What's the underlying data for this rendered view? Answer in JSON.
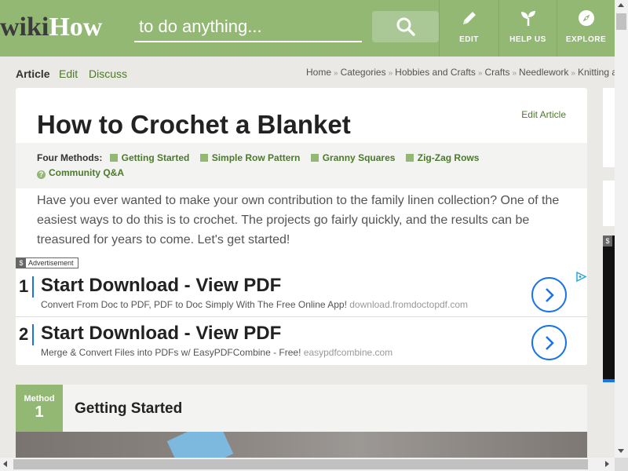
{
  "header": {
    "logo_wiki": "wiki",
    "logo_how": "How",
    "search_placeholder": "to do anything...",
    "search_icon": "search-icon",
    "buttons": [
      {
        "label": "EDIT",
        "icon": "pencil-icon"
      },
      {
        "label": "HELP US",
        "icon": "sprout-icon"
      },
      {
        "label": "EXPLORE",
        "icon": "compass-icon"
      }
    ]
  },
  "tabs": {
    "article": "Article",
    "edit": "Edit",
    "discuss": "Discuss"
  },
  "breadcrumb": [
    "Home",
    "Categories",
    "Hobbies and Crafts",
    "Crafts",
    "Needlework",
    "Knitting a"
  ],
  "breadcrumb_sep": "»",
  "article": {
    "title": "How to Crochet a Blanket",
    "edit_link": "Edit Article",
    "methods_label": "Four Methods:",
    "methods": [
      "Getting Started",
      "Simple Row Pattern",
      "Granny Squares",
      "Zig-Zag Rows"
    ],
    "qa_link": "Community Q&A",
    "intro": "Have you ever wanted to make your own contribution to the family linen collection? One of the easiest ways to do this is to crochet. The projects go fairly quickly, and the results can be treasured for years to come. Let's get started!"
  },
  "ad": {
    "label_icon": "$",
    "label": "Advertisement",
    "items": [
      {
        "num": "1",
        "title": "Start Download - View PDF",
        "desc": "Convert From Doc to PDF, PDF to Doc Simply With The Free Online App!",
        "domain": "download.fromdoctopdf.com"
      },
      {
        "num": "2",
        "title": "Start Download - View PDF",
        "desc": "Merge & Convert Files into PDFs w/ EasyPDFCombine - Free!",
        "domain": "easypdfcombine.com"
      }
    ]
  },
  "method": {
    "word": "Method",
    "number": "1",
    "title": "Getting Started"
  },
  "side_ad_tag": "$",
  "colors": {
    "brand_green": "#93b874",
    "link_green": "#4b7a2b",
    "ad_blue": "#1a73e8"
  }
}
